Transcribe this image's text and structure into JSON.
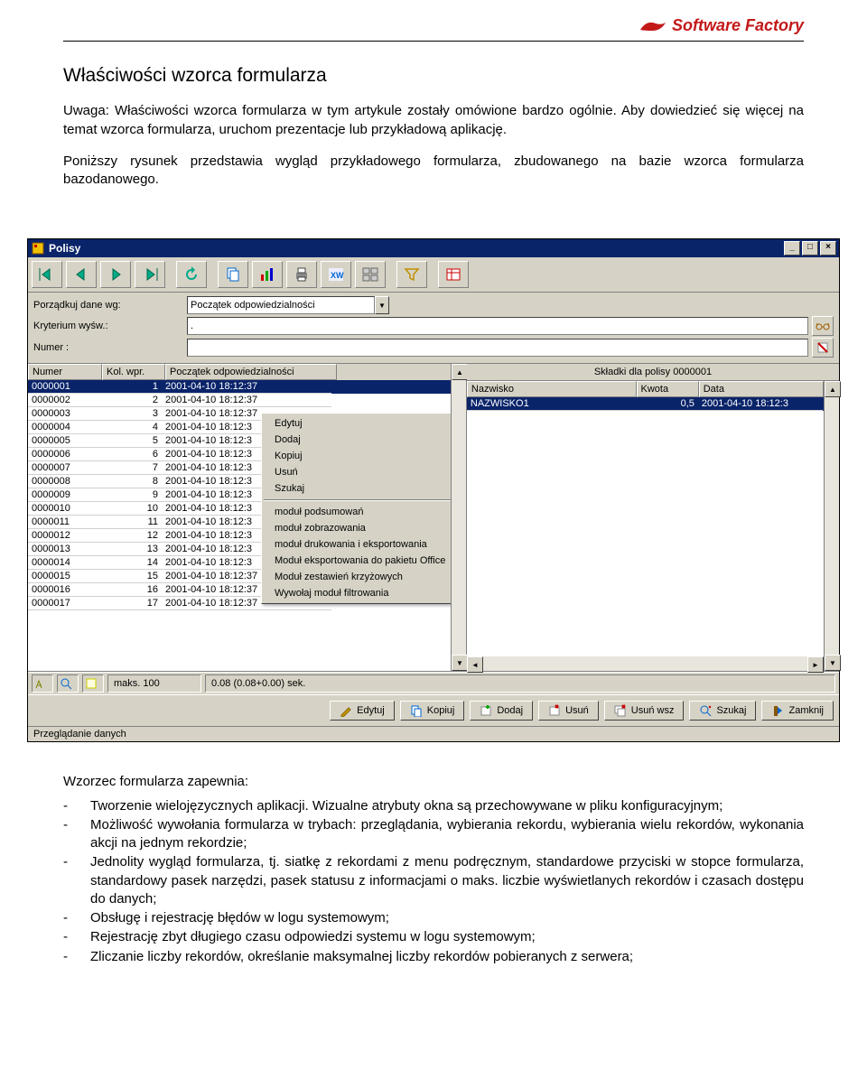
{
  "header": {
    "brand": "Software Factory"
  },
  "doc": {
    "title": "Właściwości wzorca formularza",
    "intro1": "Uwaga: Właściwości wzorca formularza w tym artykule zostały omówione bardzo ogólnie. Aby dowiedzieć się więcej na temat wzorca formularza, uruchom prezentacje lub przykładową aplikację.",
    "intro2": "Poniższy rysunek przedstawia wygląd przykładowego formularza, zbudowanego na bazie wzorca formularza bazodanowego.",
    "post_title": "Wzorzec formularza zapewnia:",
    "bullets": [
      "Tworzenie wielojęzycznych aplikacji. Wizualne atrybuty okna są przechowywane w pliku konfiguracyjnym;",
      "Możliwość wywołania formularza w trybach: przeglądania, wybierania rekordu, wybierania wielu rekordów, wykonania akcji na jednym rekordzie;",
      "Jednolity wygląd formularza, tj. siatkę z rekordami z menu podręcznym, standardowe przyciski w stopce formularza, standardowy pasek narzędzi, pasek statusu z informacjami o maks. liczbie wyświetlanych rekordów i czasach dostępu do danych;",
      "Obsługę i rejestrację błędów w logu systemowym;",
      "Rejestrację zbyt długiego czasu odpowiedzi systemu w logu systemowym;",
      "Zliczanie liczby rekordów, określanie maksymalnej liczby rekordów pobieranych z serwera;"
    ]
  },
  "win": {
    "title": "Polisy",
    "filters": {
      "sort_label": "Porządkuj dane wg:",
      "sort_value": "Początek odpowiedzialności",
      "crit_label": "Kryterium wyśw.:",
      "crit_value": ".",
      "num_label": "Numer :",
      "num_value": ""
    },
    "left": {
      "cols": [
        "Numer",
        "Kol. wpr.",
        "Początek odpowiedzialności"
      ],
      "widths": [
        72,
        60,
        180
      ],
      "rows": [
        [
          "0000001",
          "1",
          "2001-04-10 18:12:37"
        ],
        [
          "0000002",
          "2",
          "2001-04-10 18:12:37"
        ],
        [
          "0000003",
          "3",
          "2001-04-10 18:12:37"
        ],
        [
          "0000004",
          "4",
          "2001-04-10 18:12:3"
        ],
        [
          "0000005",
          "5",
          "2001-04-10 18:12:3"
        ],
        [
          "0000006",
          "6",
          "2001-04-10 18:12:3"
        ],
        [
          "0000007",
          "7",
          "2001-04-10 18:12:3"
        ],
        [
          "0000008",
          "8",
          "2001-04-10 18:12:3"
        ],
        [
          "0000009",
          "9",
          "2001-04-10 18:12:3"
        ],
        [
          "0000010",
          "10",
          "2001-04-10 18:12:3"
        ],
        [
          "0000011",
          "11",
          "2001-04-10 18:12:3"
        ],
        [
          "0000012",
          "12",
          "2001-04-10 18:12:3"
        ],
        [
          "0000013",
          "13",
          "2001-04-10 18:12:3"
        ],
        [
          "0000014",
          "14",
          "2001-04-10 18:12:3"
        ],
        [
          "0000015",
          "15",
          "2001-04-10 18:12:37"
        ],
        [
          "0000016",
          "16",
          "2001-04-10 18:12:37"
        ],
        [
          "0000017",
          "17",
          "2001-04-10 18:12:37"
        ]
      ]
    },
    "right": {
      "header": "Składki dla polisy 0000001",
      "cols": [
        "Nazwisko",
        "Kwota",
        "Data"
      ],
      "widths": [
        180,
        60,
        130
      ],
      "rows": [
        [
          "NAZWISKO1",
          "0,5",
          "2001-04-10 18:12:3"
        ]
      ]
    },
    "context_menu": {
      "group1": [
        "Edytuj",
        "Dodaj",
        "Kopiuj",
        "Usuń",
        "Szukaj"
      ],
      "group2": [
        "moduł podsumowań",
        "moduł zobrazowania",
        "moduł drukowania i eksportowania",
        "Moduł eksportowania do pakietu Office",
        "Moduł zestawień krzyżowych",
        "Wywołaj moduł filtrowania"
      ]
    },
    "status": {
      "maks": "maks. 100",
      "time": "0.08 (0.08+0.00) sek."
    },
    "actions": [
      "Edytuj",
      "Kopiuj",
      "Dodaj",
      "Usuń",
      "Usuń wsz",
      "Szukaj",
      "Zamknij"
    ],
    "footer": "Przeglądanie danych"
  }
}
